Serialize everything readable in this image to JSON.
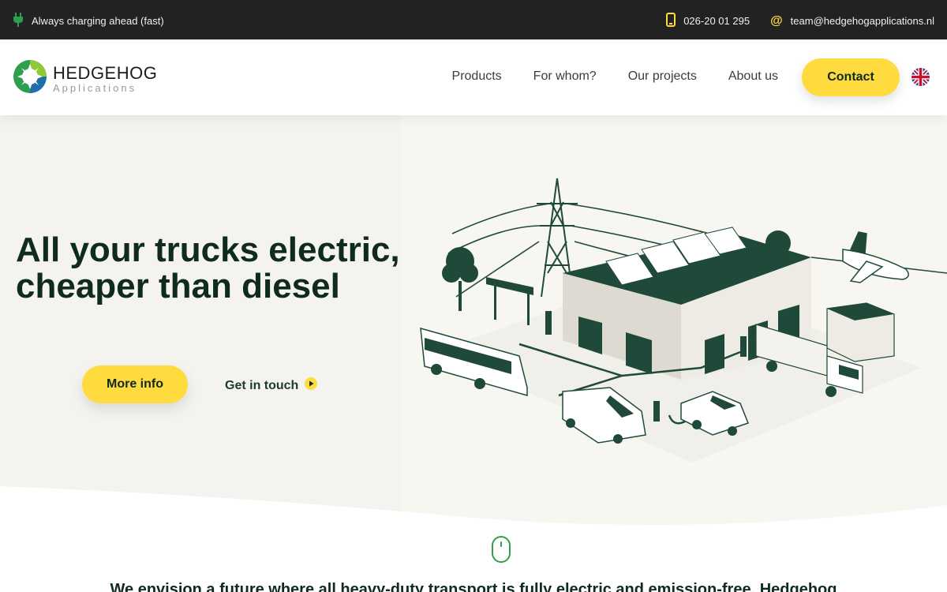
{
  "topbar": {
    "tagline": "Always charging ahead (fast)",
    "phone": "026-20 01 295",
    "email": "team@hedgehogapplications.nl",
    "icons": {
      "tagline": "plug-icon",
      "phone": "phone-icon",
      "email": "at-sign-icon"
    }
  },
  "header": {
    "logo_name": "HEDGEHOG",
    "logo_sub": "Applications",
    "nav": [
      "Products",
      "For whom?",
      "Our projects",
      "About us"
    ],
    "contact_label": "Contact",
    "language_icon": "uk-flag-icon"
  },
  "hero": {
    "title_line1": "All your trucks electric,",
    "title_line2": "cheaper than diesel",
    "more_info_label": "More info",
    "get_in_touch_label": "Get in touch"
  },
  "intro": {
    "text": "We envision a future where all heavy-duty transport is fully electric and emission-free. Hedgehog"
  },
  "colors": {
    "accent_yellow": "#ffdb3f",
    "brand_dark_green": "#0f2a1e",
    "brand_green": "#2e9e4f",
    "topbar_bg": "#222222",
    "hero_bg": "#f5f3ef"
  }
}
